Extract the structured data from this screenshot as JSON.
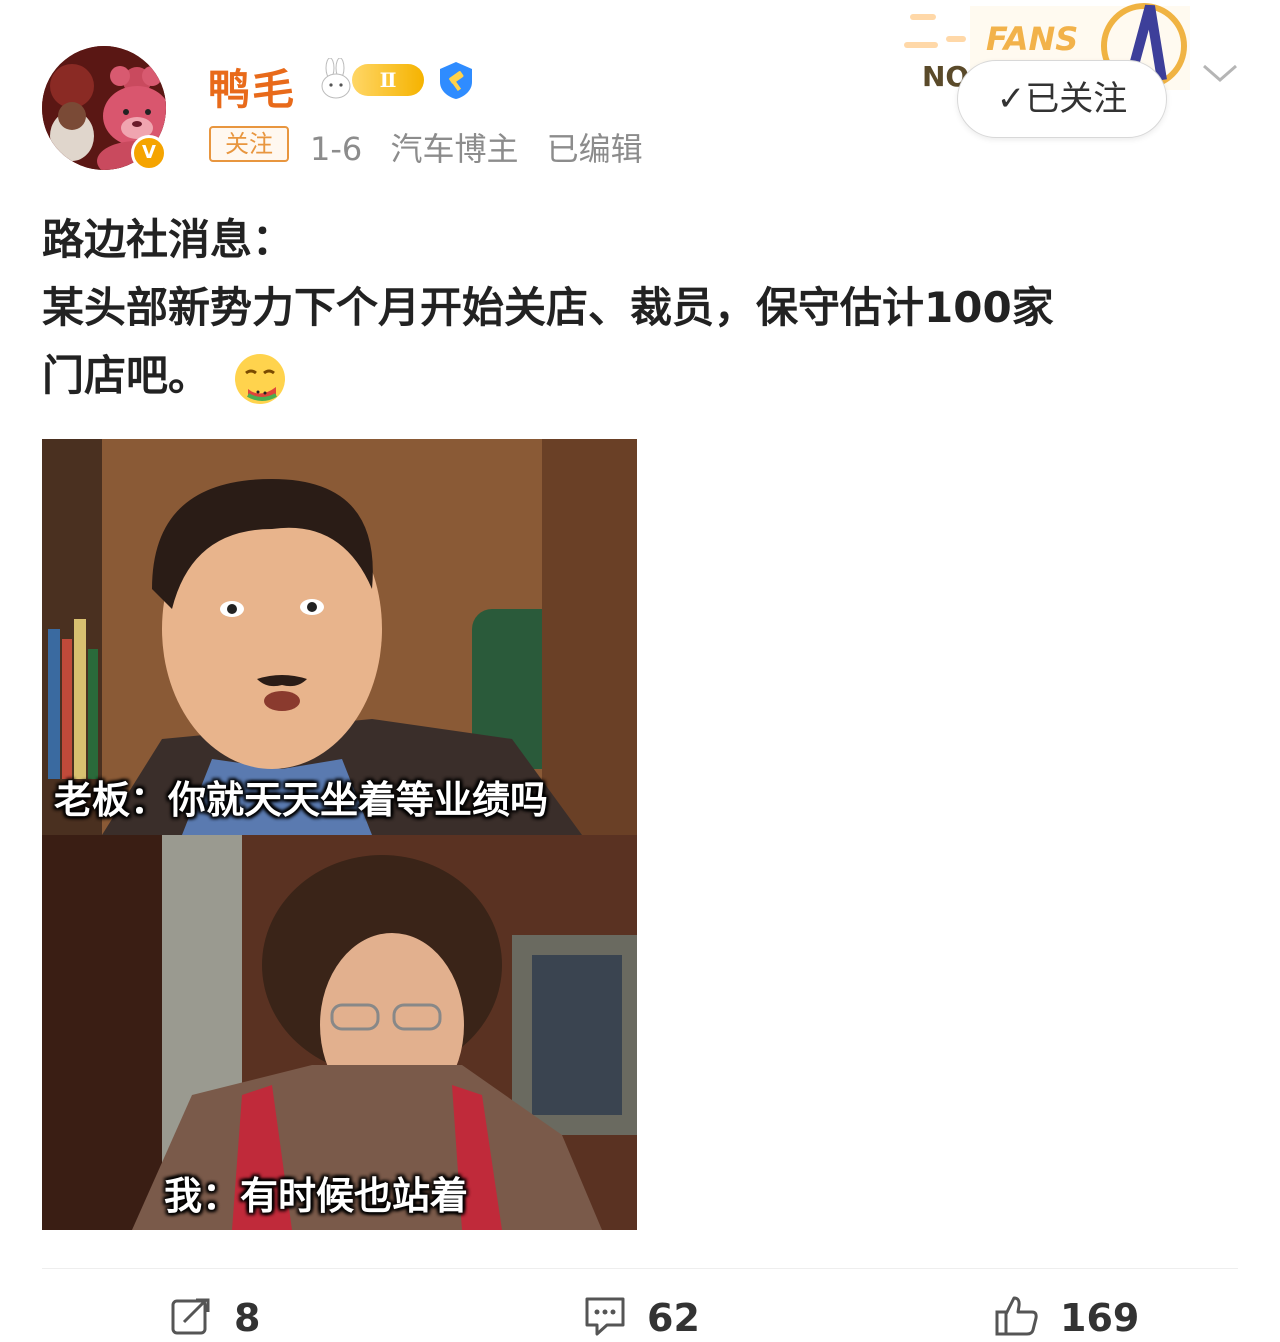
{
  "user": {
    "name": "鸭毛",
    "level_badge": "Ⅱ",
    "verified_mark": "V",
    "follow_tag": "关注",
    "post_date": "1-6",
    "identity": "汽车博主",
    "edited": "已编辑"
  },
  "header": {
    "fans_banner_text": "FANS",
    "fans_banner_no": "NO",
    "followed_button": "✓已关注"
  },
  "post": {
    "lines": [
      "路边社消息：",
      "某头部新势力下个月开始关店、裁员，保守估计100家",
      "门店吧。"
    ],
    "emoji": "watermelon-eating-emoji"
  },
  "meme": {
    "caption_top": "老板：你就天天坐着等业绩吗",
    "caption_bottom": "我：有时候也站着"
  },
  "actions": {
    "repost_count": "8",
    "comment_count": "62",
    "like_count": "169"
  },
  "icons": {
    "repost": "repost-icon",
    "comment": "comment-icon",
    "like": "thumbs-up-icon",
    "chevron": "chevron-down-icon"
  },
  "colors": {
    "username": "#e86a1a",
    "tag_border": "#e8963f",
    "meta_text": "#8c8c8c",
    "verified": "#f5a400"
  }
}
